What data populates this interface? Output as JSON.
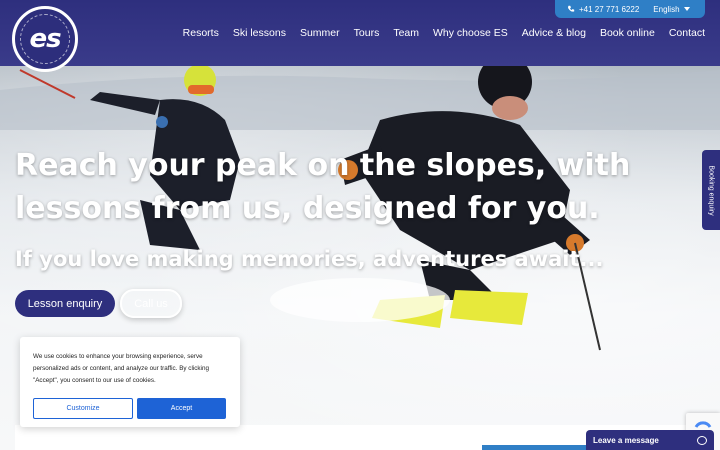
{
  "colors": {
    "brand_navy": "#2e2f7e",
    "accent_blue": "#2f7fc6",
    "cookie_blue": "#1e63d6"
  },
  "logo": {
    "text": "es",
    "ring_text": "european snowsport · ski and snowboard school"
  },
  "topbar": {
    "phone_icon": "phone-icon",
    "phone": "+41 27 771 6222",
    "language": "English",
    "language_icon": "caret-down-icon"
  },
  "nav": {
    "items": [
      "Resorts",
      "Ski lessons",
      "Summer",
      "Tours",
      "Team",
      "Why choose ES",
      "Advice & blog",
      "Book online",
      "Contact"
    ]
  },
  "hero": {
    "headline": "Reach your peak on the slopes, with lessons from us, designed for you.",
    "subline": "If you love making memories, adventures await...",
    "primary_button": "Lesson enquiry",
    "secondary_button": "Call us"
  },
  "side_tab": {
    "label": "Booking enquiry"
  },
  "cookie": {
    "text": "We use cookies to enhance your browsing experience, serve personalized ads or content, and analyze our traffic. By clicking \"Accept\", you consent to our use of cookies.",
    "customize": "Customize",
    "accept": "Accept"
  },
  "chat": {
    "label": "Leave a message",
    "icon": "chat-bubble-icon"
  }
}
